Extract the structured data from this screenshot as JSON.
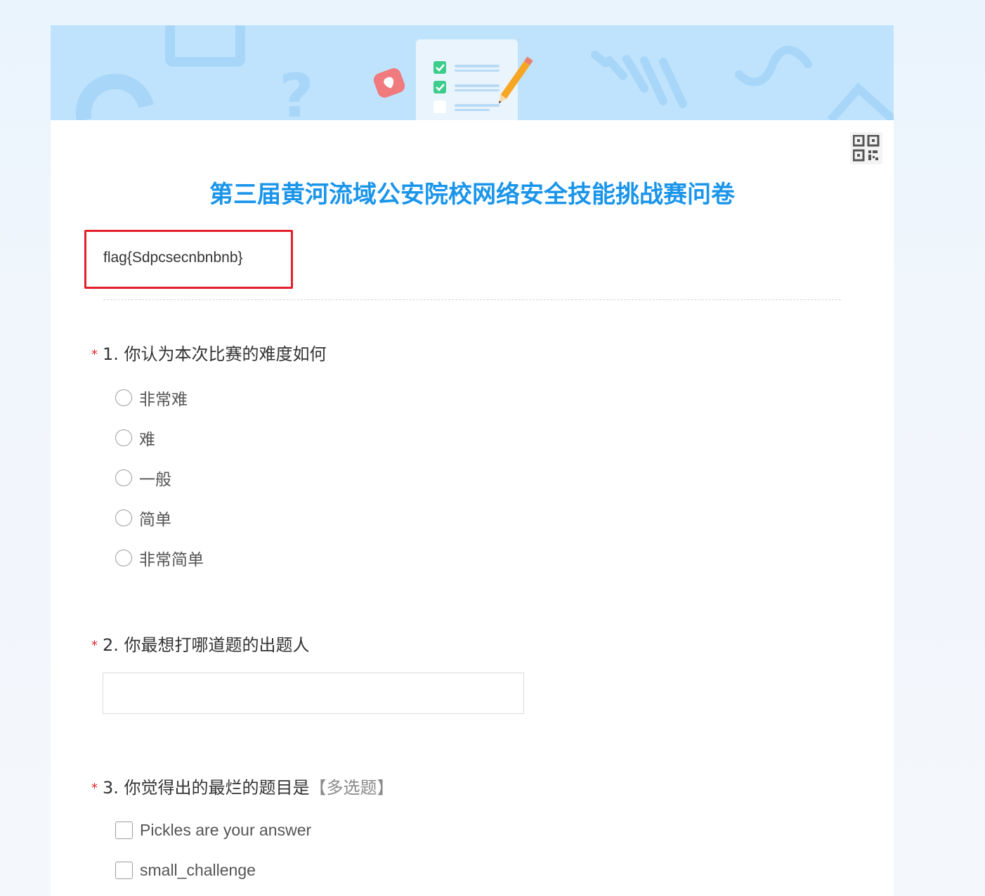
{
  "survey": {
    "title": "第三届黄河流域公安院校网络安全技能挑战赛问卷",
    "description": "flag{Sdpcsecnbnbnb}"
  },
  "questions": [
    {
      "number": "1.",
      "required_mark": "*",
      "text": "你认为本次比赛的难度如何",
      "type": "radio",
      "options": [
        "非常难",
        "难",
        "一般",
        "简单",
        "非常简单"
      ]
    },
    {
      "number": "2.",
      "required_mark": "*",
      "text": "你最想打哪道题的出题人",
      "type": "text",
      "value": ""
    },
    {
      "number": "3.",
      "required_mark": "*",
      "text": "你觉得出的最烂的题目是",
      "hint": "【多选题】",
      "type": "checkbox",
      "options": [
        "Pickles are your answer",
        "small_challenge"
      ]
    }
  ],
  "icons": {
    "qr": "qr-code-icon",
    "banner": "survey-checklist-illustration"
  },
  "colors": {
    "title": "#1a95ea",
    "banner": "#bfe3fc",
    "required": "#e3212b",
    "highlight_box": "#e3212b"
  }
}
